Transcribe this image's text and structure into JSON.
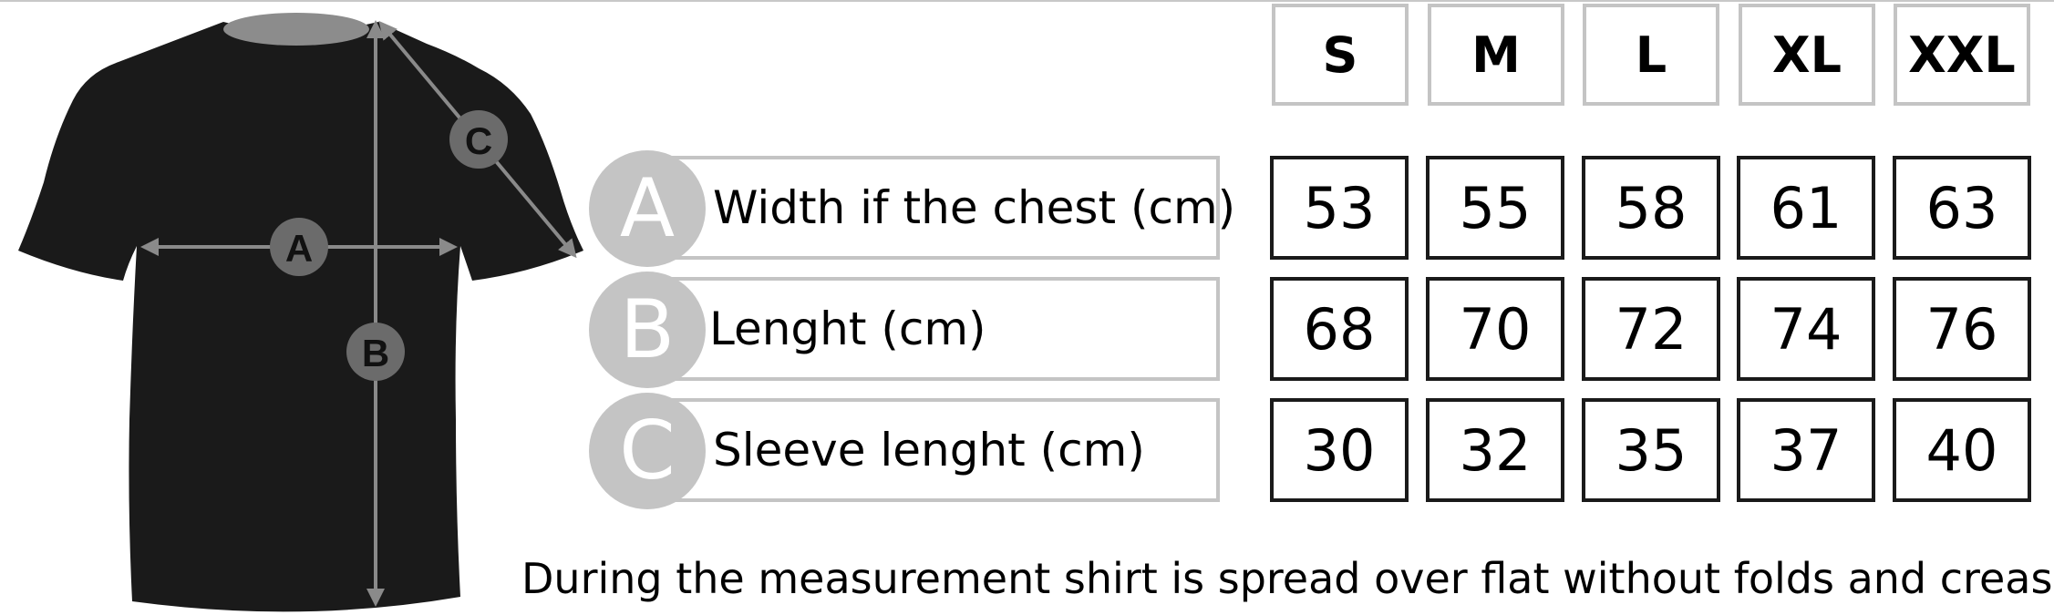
{
  "sizes": [
    "S",
    "M",
    "L",
    "XL",
    "XXL"
  ],
  "rows": [
    {
      "letter": "A",
      "label": "Width if the chest (cm)",
      "values": [
        "53",
        "55",
        "58",
        "61",
        "63"
      ]
    },
    {
      "letter": "B",
      "label": "Lenght (cm)",
      "values": [
        "68",
        "70",
        "72",
        "74",
        "76"
      ]
    },
    {
      "letter": "C",
      "label": "Sleeve lenght (cm)",
      "values": [
        "30",
        "32",
        "35",
        "37",
        "40"
      ]
    }
  ],
  "shirt_markers": {
    "a": "A",
    "b": "B",
    "c": "C"
  },
  "footnote": "During the measurement shirt is spread over flat without folds and creasesmeasur",
  "colors": {
    "shirt": "#1a1a1a",
    "marker": "#6b6b6b",
    "arrow": "#8a8a8a",
    "light_border": "#c4c4c4"
  }
}
